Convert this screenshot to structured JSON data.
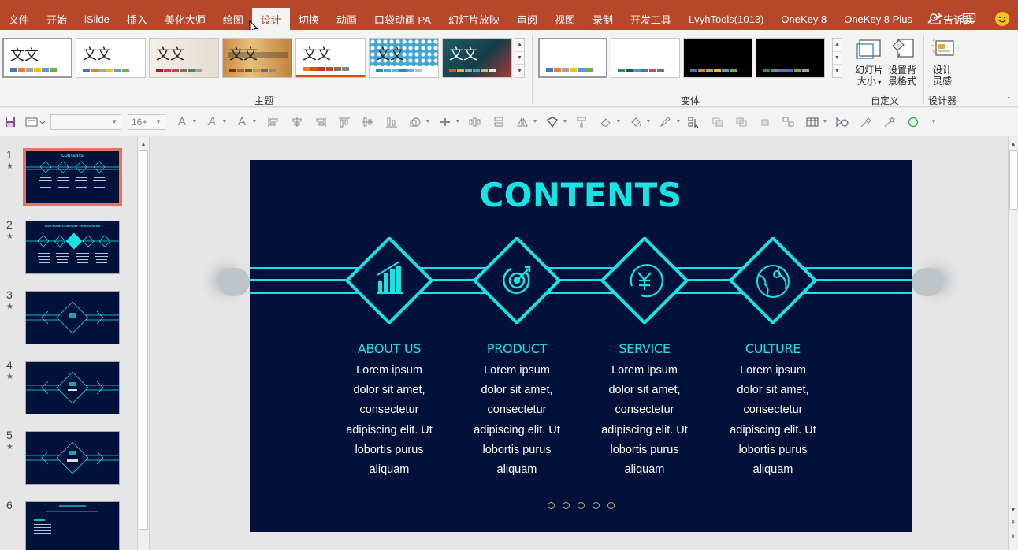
{
  "menu": {
    "tabs": [
      "文件",
      "开始",
      "iSlide",
      "插入",
      "美化大师",
      "绘图",
      "设计",
      "切换",
      "动画",
      "口袋动画 PA",
      "幻灯片放映",
      "审阅",
      "视图",
      "录制",
      "开发工具",
      "LvyhTools(1013)",
      "OneKey 8",
      "OneKey 8 Plus"
    ],
    "active_tab": "设计",
    "tell_me": "告诉我"
  },
  "ribbon": {
    "theme_sample_text": "文文",
    "theme_group_label": "主题",
    "variant_group_label": "变体",
    "slide_size_label_1": "幻灯片",
    "slide_size_label_2": "大小",
    "format_bg_label_1": "设置背",
    "format_bg_label_2": "景格式",
    "customize_group_label": "自定义",
    "design_ideas_label_1": "设计",
    "design_ideas_label_2": "灵感",
    "designer_group_label": "设计器"
  },
  "toolbar": {
    "font_name": "",
    "font_size": "16+"
  },
  "slides_panel": {
    "numbers": [
      "1",
      "2",
      "3",
      "4",
      "5",
      "6"
    ],
    "active": 0,
    "star": "★",
    "thumb1_title": "CONTENTS",
    "thumb2_title": "ADD YOUR COMPANY THINGS HERE"
  },
  "slide": {
    "title": "CONTENTS",
    "columns": [
      {
        "heading": "ABOUT US",
        "icon": "building-chart-icon",
        "body": [
          "Lorem ipsum",
          "dolor sit amet,",
          "consectetur",
          "adipiscing elit. Ut",
          "lobortis purus",
          "aliquam"
        ]
      },
      {
        "heading": "PRODUCT",
        "icon": "target-icon",
        "body": [
          "Lorem ipsum",
          "dolor sit amet,",
          "consectetur",
          "adipiscing elit. Ut",
          "lobortis purus",
          "aliquam"
        ]
      },
      {
        "heading": "SERVICE",
        "icon": "yen-coin-icon",
        "body": [
          "Lorem ipsum",
          "dolor sit amet,",
          "consectetur",
          "adipiscing elit. Ut",
          "lobortis purus",
          "aliquam"
        ]
      },
      {
        "heading": "CULTURE",
        "icon": "globe-icon",
        "body": [
          "Lorem ipsum",
          "dolor sit amet,",
          "consectetur",
          "adipiscing elit. Ut",
          "lobortis purus",
          "aliquam"
        ]
      }
    ],
    "page_dots": 5
  },
  "colors": {
    "menubar": "#b7472a",
    "slide_bg": "#01123a",
    "accent": "#16e4e4",
    "dot": "#c8a675"
  }
}
